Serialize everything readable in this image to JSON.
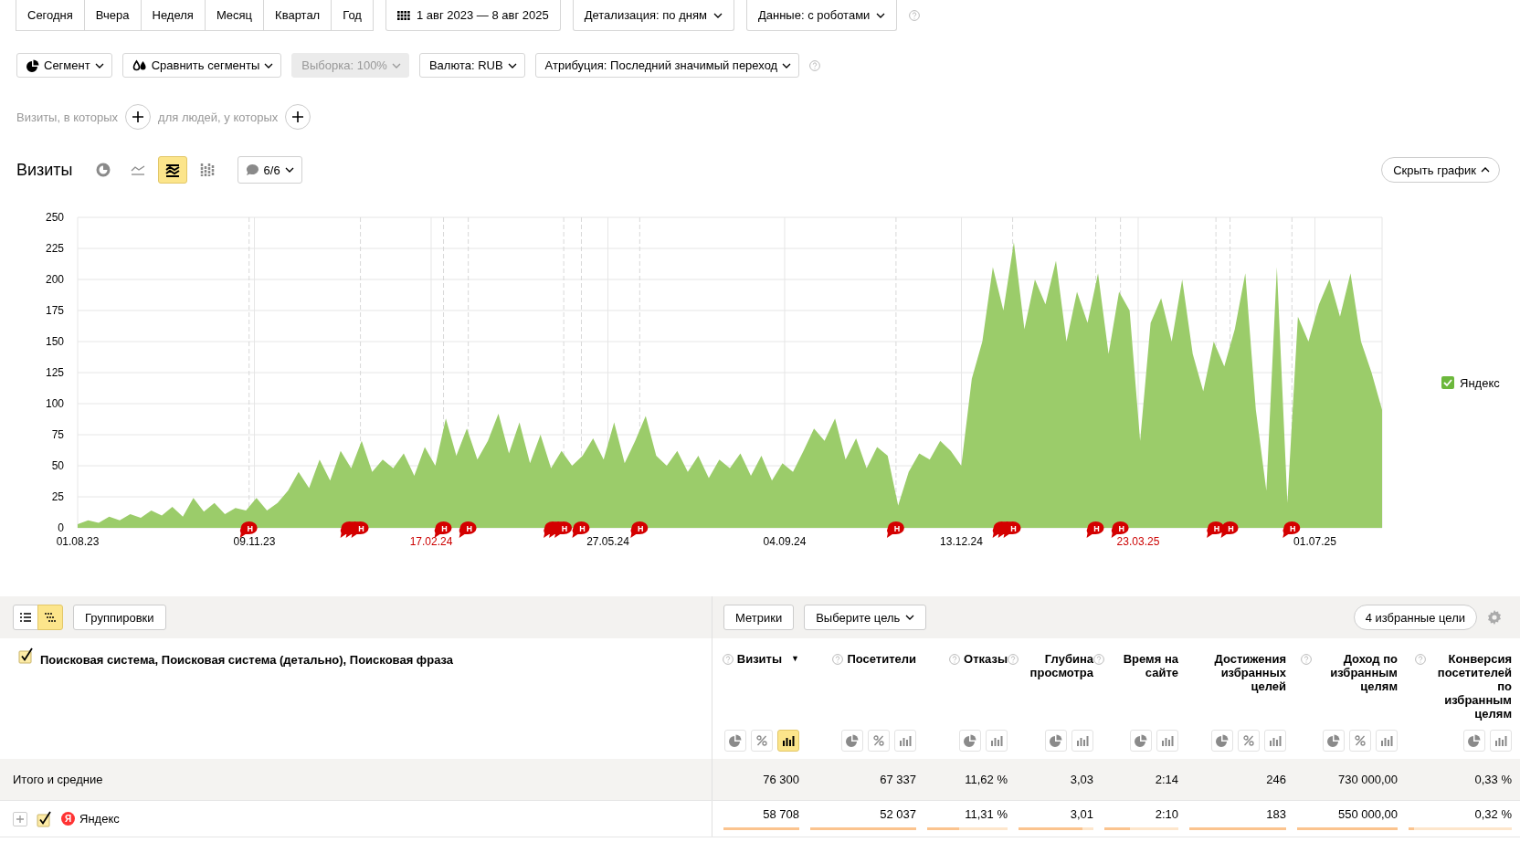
{
  "period_buttons": [
    {
      "label": "Сегодня",
      "selected": false
    },
    {
      "label": "Вчера",
      "selected": false
    },
    {
      "label": "Неделя",
      "selected": false
    },
    {
      "label": "Месяц",
      "selected": false
    },
    {
      "label": "Квартал",
      "selected": false
    },
    {
      "label": "Год",
      "selected": false
    }
  ],
  "date_range": "1 авг 2023 — 8 авг 2025",
  "top_dropdowns": [
    {
      "label": "Детализация: по дням"
    },
    {
      "label": "Данные: с роботами"
    }
  ],
  "filters": [
    {
      "label": "Сегмент",
      "kind": "segment",
      "disabled": false
    },
    {
      "label": "Сравнить сегменты",
      "kind": "compare",
      "disabled": false
    },
    {
      "label": "Выборка: 100%",
      "kind": "plain",
      "disabled": true
    },
    {
      "label": "Валюта: RUB",
      "kind": "plain",
      "disabled": false
    },
    {
      "label": "Атрибуция: Последний значимый переход",
      "kind": "plain",
      "disabled": false
    }
  ],
  "conditions": [
    {
      "label": "Визиты, в которых"
    },
    {
      "label": "для людей, у которых"
    }
  ],
  "chart": {
    "title": "Визиты",
    "types": [
      {
        "kind": "pie",
        "selected": false
      },
      {
        "kind": "line",
        "selected": false
      },
      {
        "kind": "area",
        "selected": true
      },
      {
        "kind": "bars",
        "selected": false
      }
    ],
    "notes_filter": "6/6",
    "hide_button": "Скрыть график",
    "legend_checked": true,
    "x_labels": [
      {
        "label": "01.08.23",
        "holiday": false
      },
      {
        "label": "09.11.23",
        "holiday": false
      },
      {
        "label": "17.02.24",
        "holiday": true
      },
      {
        "label": "27.05.24",
        "holiday": false
      },
      {
        "label": "04.09.24",
        "holiday": false
      },
      {
        "label": "13.12.24",
        "holiday": false
      },
      {
        "label": "23.03.25",
        "holiday": true
      },
      {
        "label": "01.07.25",
        "holiday": false
      }
    ],
    "notes": [
      {
        "label": "Н",
        "stacked": false
      },
      {
        "label": "Н",
        "stacked": true
      },
      {
        "label": "Н",
        "stacked": false
      },
      {
        "label": "Н",
        "stacked": false
      },
      {
        "label": "Н",
        "stacked": true
      },
      {
        "label": "Н",
        "stacked": false
      },
      {
        "label": "Н",
        "stacked": false
      },
      {
        "label": "Н",
        "stacked": false
      },
      {
        "label": "Н",
        "stacked": true
      },
      {
        "label": "Н",
        "stacked": false
      },
      {
        "label": "Н",
        "stacked": false
      },
      {
        "label": "Н",
        "stacked": false
      },
      {
        "label": "Н",
        "stacked": false
      },
      {
        "label": "Н",
        "stacked": false
      }
    ],
    "chart_data": {
      "type": "area",
      "ylim": [
        0,
        250
      ],
      "grid": true,
      "yticks": [
        0,
        25,
        50,
        75,
        100,
        125,
        150,
        175,
        200,
        225,
        250
      ],
      "series": [
        {
          "name": "Яндекс",
          "color": "#9bcc6a",
          "values": [
            3,
            6,
            4,
            9,
            6,
            11,
            8,
            14,
            10,
            17,
            9,
            24,
            13,
            20,
            11,
            16,
            14,
            24,
            14,
            20,
            30,
            45,
            32,
            55,
            38,
            62,
            48,
            70,
            45,
            55,
            48,
            60,
            42,
            65,
            50,
            88,
            58,
            80,
            55,
            70,
            92,
            60,
            85,
            52,
            75,
            48,
            62,
            50,
            58,
            72,
            55,
            85,
            52,
            70,
            90,
            58,
            50,
            62,
            45,
            58,
            40,
            55,
            48,
            60,
            42,
            58,
            38,
            52,
            45,
            62,
            80,
            70,
            88,
            55,
            72,
            48,
            65,
            58,
            18,
            45,
            60,
            55,
            70,
            62,
            50,
            120,
            150,
            210,
            175,
            230,
            160,
            200,
            180,
            215,
            150,
            190,
            165,
            205,
            140,
            190,
            175,
            70,
            165,
            185,
            150,
            200,
            140,
            110,
            150,
            130,
            160,
            205,
            95,
            30,
            210,
            20,
            170,
            150,
            180,
            200,
            170,
            205,
            150,
            125,
            95
          ]
        }
      ]
    }
  },
  "table": {
    "view_modes": [
      {
        "kind": "list",
        "selected": false
      },
      {
        "kind": "tree",
        "selected": true
      }
    ],
    "groupings_button": "Группировки",
    "metrics_button": "Метрики",
    "goal_dropdown": "Выберите цель",
    "favorites_button": "4 избранные цели",
    "dimensions": {
      "label": "Поисковая система, Поисковая система (детально), Поисковая фраза",
      "checked": true
    },
    "columns": [
      {
        "label": "Визиты",
        "help": true,
        "sort_indicator": "▼",
        "tools": [
          {
            "kind": "pie",
            "selected": false
          },
          {
            "kind": "percent",
            "selected": false
          },
          {
            "kind": "bars",
            "selected": true
          }
        ]
      },
      {
        "label": "Посетители",
        "help": true,
        "tools": [
          {
            "kind": "pie",
            "selected": false
          },
          {
            "kind": "percent",
            "selected": false
          },
          {
            "kind": "bars",
            "selected": false
          }
        ]
      },
      {
        "label": "Отказы",
        "help": true,
        "tools": [
          {
            "kind": "pie",
            "selected": false
          },
          {
            "kind": "bars",
            "selected": false
          }
        ]
      },
      {
        "label": "Глубина просмотра",
        "help": true,
        "tools": [
          {
            "kind": "pie",
            "selected": false
          },
          {
            "kind": "bars",
            "selected": false
          }
        ]
      },
      {
        "label": "Время на сайте",
        "help": true,
        "tools": [
          {
            "kind": "pie",
            "selected": false
          },
          {
            "kind": "bars",
            "selected": false
          }
        ]
      },
      {
        "label": "Достижения избранных целей",
        "help": false,
        "tools": [
          {
            "kind": "pie",
            "selected": false
          },
          {
            "kind": "percent",
            "selected": false
          },
          {
            "kind": "bars",
            "selected": false
          }
        ]
      },
      {
        "label": "Доход по избранным целям",
        "help": true,
        "tools": [
          {
            "kind": "pie",
            "selected": false
          },
          {
            "kind": "percent",
            "selected": false
          },
          {
            "kind": "bars",
            "selected": false
          }
        ]
      },
      {
        "label": "Конверсия посетителей по избранным целям",
        "help": true,
        "tools": [
          {
            "kind": "pie",
            "selected": false
          },
          {
            "kind": "bars",
            "selected": false
          }
        ]
      }
    ],
    "totals": {
      "label": "Итого и средние",
      "values": [
        "76 300",
        "67 337",
        "11,62 %",
        "3,03",
        "2:14",
        "246",
        "730 000,00",
        "0,33 %"
      ]
    },
    "rows": [
      {
        "label": "Яндекс",
        "logo": "Я",
        "expanded": false,
        "checked": true,
        "cells": [
          {
            "value": "58 708",
            "level": 1
          },
          {
            "value": "52 037",
            "level": 1
          },
          {
            "value": "11,31 %",
            "level": 0.4
          },
          {
            "value": "3,01",
            "level": 0.85
          },
          {
            "value": "2:10",
            "level": 0.35
          },
          {
            "value": "183",
            "level": 1
          },
          {
            "value": "550 000,00",
            "level": 1
          },
          {
            "value": "0,32 %",
            "level": 0.05
          }
        ]
      }
    ]
  }
}
